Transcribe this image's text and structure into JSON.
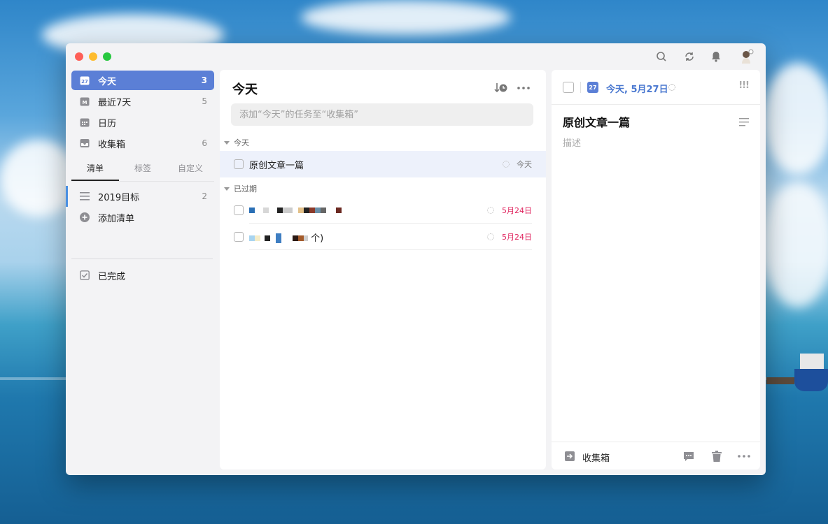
{
  "sidebar": {
    "items": [
      {
        "label": "今天",
        "count": "3",
        "icon": "calendar-today-icon",
        "icon_text": "27"
      },
      {
        "label": "最近7天",
        "count": "5",
        "icon": "calendar-week-icon",
        "icon_text": "M"
      },
      {
        "label": "日历",
        "count": "",
        "icon": "calendar-icon"
      },
      {
        "label": "收集箱",
        "count": "6",
        "icon": "inbox-icon"
      }
    ],
    "tabs": [
      "清单",
      "标签",
      "自定义"
    ],
    "lists": [
      {
        "label": "2019目标",
        "count": "2",
        "icon": "list-icon"
      },
      {
        "label": "添加清单",
        "icon": "add-circle-icon"
      }
    ],
    "completed_label": "已完成"
  },
  "middle": {
    "title": "今天",
    "add_placeholder": "添加“今天”的任务至“收集箱”",
    "groups": [
      {
        "name": "今天",
        "tasks": [
          {
            "title": "原创文章一篇",
            "date": "今天"
          }
        ]
      },
      {
        "name": "已过期",
        "tasks": [
          {
            "title": "",
            "date": "5月24日"
          },
          {
            "title": "个)",
            "date": "5月24日"
          }
        ]
      }
    ]
  },
  "detail": {
    "date_label": "今天, 5月27日",
    "calendar_day": "27",
    "priority": "!!!",
    "title": "原创文章一篇",
    "description_placeholder": "描述",
    "list_name": "收集箱"
  },
  "colors": {
    "accent": "#5b7fd6",
    "overdue": "#e0245e",
    "today_date": "#4a78d0"
  }
}
